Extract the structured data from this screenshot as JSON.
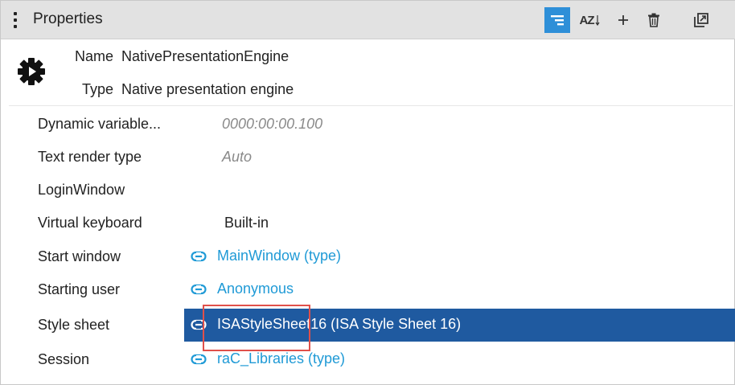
{
  "panel": {
    "title": "Properties",
    "toolbar": {
      "group_icon": "group-by-category-icon",
      "sort_label": "AZ",
      "add_icon": "plus-icon",
      "delete_icon": "trash-icon",
      "popout_icon": "popout-icon"
    }
  },
  "object": {
    "icon": "gear-icon",
    "name_key": "Name",
    "name_value": "NativePresentationEngine",
    "type_key": "Type",
    "type_value": "Native presentation engine"
  },
  "properties": [
    {
      "label": "Dynamic variable...",
      "value": "0000:00:00.100"
    },
    {
      "label": "Text render type",
      "value": "Auto"
    },
    {
      "label": "LoginWindow",
      "value": ""
    },
    {
      "label": "Virtual keyboard",
      "value": "Built-in"
    },
    {
      "label": "Start window",
      "value": "MainWindow (type)"
    },
    {
      "label": "Starting user",
      "value": "Anonymous"
    },
    {
      "label": "Style sheet",
      "value": "ISAStyleSheet16 (ISA Style Sheet 16)"
    },
    {
      "label": "Session",
      "value": "raC_Libraries (type)"
    }
  ],
  "colors": {
    "accent": "#2e8fd8",
    "selection": "#1f5aa0",
    "link": "#1f9ad6",
    "highlight_box": "#e0504a"
  }
}
